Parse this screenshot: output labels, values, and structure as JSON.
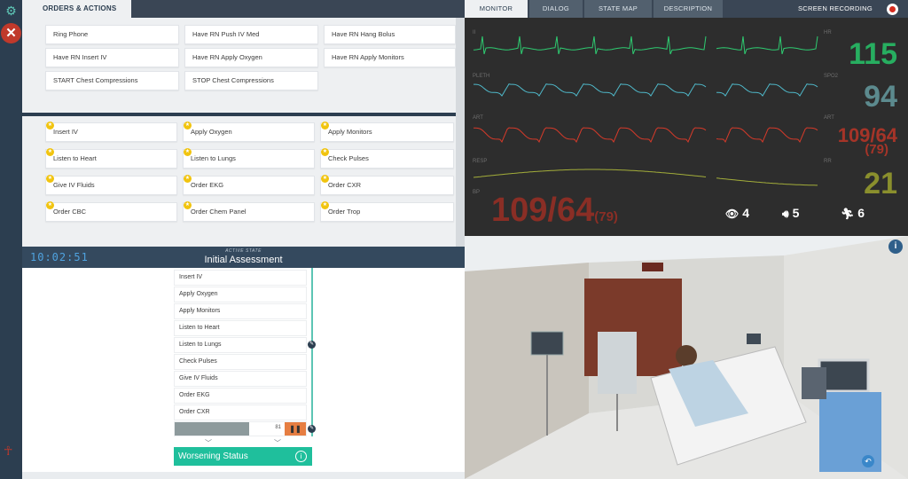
{
  "left_tab": {
    "label": "ORDERS & ACTIONS"
  },
  "orders": [
    "Ring Phone",
    "Have RN Push IV Med",
    "Have RN Hang Bolus",
    "Have RN Insert IV",
    "Have RN Apply Oxygen",
    "Have RN Apply Monitors",
    "START Chest Compressions",
    "STOP Chest Compressions"
  ],
  "actions": [
    "Insert IV",
    "Apply Oxygen",
    "Apply Monitors",
    "Listen to Heart",
    "Listen to Lungs",
    "Check Pulses",
    "Give IV Fluids",
    "Order EKG",
    "Order CXR",
    "Order CBC",
    "Order Chem Panel",
    "Order Trop"
  ],
  "state": {
    "timer": "10:02:51",
    "label": "ACTIVE STATE",
    "title": "Initial Assessment"
  },
  "timeline_items": [
    "Insert IV",
    "Apply Oxygen",
    "Apply Monitors",
    "Listen to Heart",
    "Listen to Lungs",
    "Check Pulses",
    "Give IV Fluids",
    "Order EKG",
    "Order CXR"
  ],
  "progress": {
    "value": "81",
    "fraction": 0.57
  },
  "worsening": {
    "label": "Worsening Status"
  },
  "right_tabs": [
    "MONITOR",
    "DIALOG",
    "STATE MAP",
    "DESCRIPTION"
  ],
  "recording": {
    "label": "SCREEN RECORDING"
  },
  "monitor": {
    "wave_labels": [
      "II",
      "PLETH",
      "ART",
      "RESP",
      "BP"
    ],
    "hr": {
      "label": "HR",
      "value": "115",
      "color": "#27ae60"
    },
    "spo2": {
      "label": "SPO2",
      "value": "94",
      "color": "#5c8a8e"
    },
    "art": {
      "label": "ART",
      "value": "109/64",
      "map": "(79)",
      "color": "#a53428"
    },
    "rr": {
      "label": "RR",
      "value": "21",
      "color": "#8a8f2d"
    },
    "bp": {
      "value": "109/64",
      "map": "(79)"
    },
    "counters": {
      "views": "4",
      "sound": "5",
      "actions": "6"
    }
  },
  "colors": {
    "ecg": "#2ecc71",
    "pleth": "#4fb8c9",
    "art": "#d63a2a",
    "resp": "#a3ad3a"
  }
}
